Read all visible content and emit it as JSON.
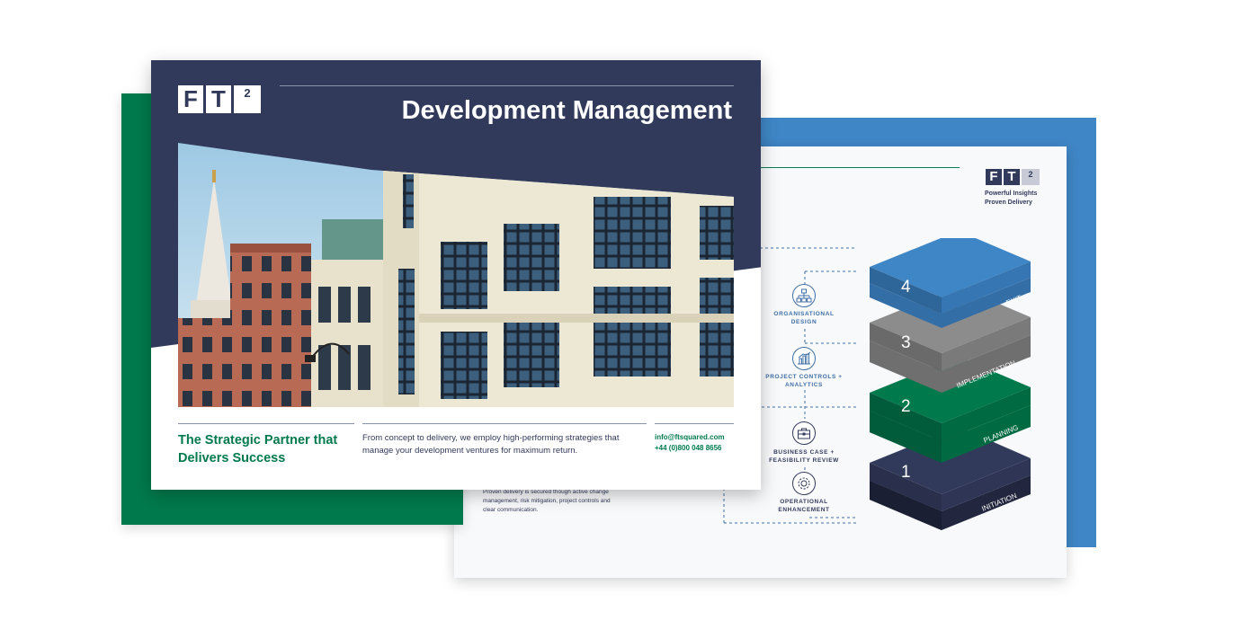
{
  "front": {
    "logo": {
      "letters": [
        "F",
        "T"
      ],
      "superscript": "2"
    },
    "title": "Development Management",
    "tagline": "The Strategic Partner that Delivers Success",
    "description": "From concept to delivery, we employ high-performing strategies that manage your development ventures for maximum return.",
    "email": "info@ftsquared.com",
    "phone": "+44 (0)800 048 8656"
  },
  "back": {
    "logo": {
      "letters": [
        "F",
        "T"
      ],
      "superscript": "2"
    },
    "tagline_line1": "Powerful Insights",
    "tagline_line2": "Proven Delivery",
    "body_text": "Proven delivery is secured though active change management, risk mitigation, project controls and clear communication.",
    "services": [
      {
        "label_line1": "ORGANISATIONAL",
        "label_line2": "DESIGN",
        "icon": "org-chart-icon"
      },
      {
        "label_line1": "PROJECT CONTROLS +",
        "label_line2": "ANALYTICS",
        "icon": "analytics-chart-icon"
      },
      {
        "label_line1": "BUSINESS CASE +",
        "label_line2": "FEASIBILITY REVIEW",
        "icon": "briefcase-icon"
      },
      {
        "label_line1": "OPERATIONAL",
        "label_line2": "ENHANCEMENT",
        "icon": "gear-icon"
      }
    ],
    "stages": [
      {
        "number": "4",
        "label": "EXIT",
        "color": "#3f86c6"
      },
      {
        "number": "3",
        "label": "IMPLEMENTATION",
        "color": "#8c8c8c"
      },
      {
        "number": "2",
        "label": "PLANNING",
        "color": "#007a4d"
      },
      {
        "number": "1",
        "label": "INITIATION",
        "color": "#323a5b"
      }
    ]
  },
  "colors": {
    "navy": "#323a5b",
    "green": "#007a4d",
    "blue": "#3f86c6",
    "grey": "#8c8c8c"
  }
}
